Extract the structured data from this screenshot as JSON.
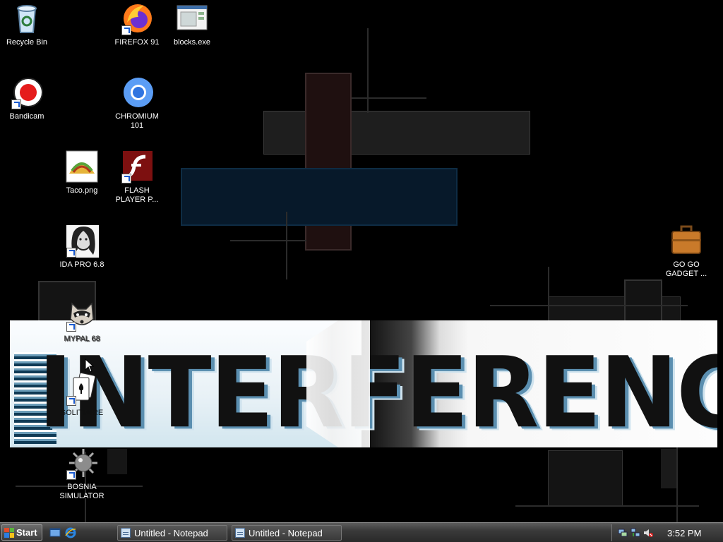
{
  "desktop": {
    "icons": [
      {
        "label": "Recycle Bin",
        "icon": "recycle-bin-icon"
      },
      {
        "label": "FIREFOX 91",
        "icon": "firefox-icon"
      },
      {
        "label": "blocks.exe",
        "icon": "blocks-app-icon"
      },
      {
        "label": "Bandicam",
        "icon": "bandicam-icon"
      },
      {
        "label": "CHROMIUM 101",
        "icon": "chromium-icon"
      },
      {
        "label": "Taco.png",
        "icon": "taco-image-icon"
      },
      {
        "label": "FLASH PLAYER P...",
        "icon": "flash-player-icon"
      },
      {
        "label": "IDA PRO 6.8",
        "icon": "ida-pro-icon"
      },
      {
        "label": "GO GO GADGET ...",
        "icon": "briefcase-icon"
      },
      {
        "label": "MYPAL 68",
        "icon": "mypal-raccoon-icon"
      },
      {
        "label": "SOLITIAIRE",
        "icon": "solitaire-cards-icon"
      },
      {
        "label": "BOSNIA SIMULATOR",
        "icon": "mine-icon"
      }
    ],
    "banner_text": "INTERFERENCE"
  },
  "taskbar": {
    "start_label": "Start",
    "quick_launch": [
      {
        "icon": "show-desktop-icon"
      },
      {
        "icon": "internet-explorer-icon"
      }
    ],
    "tasks": [
      {
        "label": "Untitled - Notepad",
        "icon": "notepad-icon"
      },
      {
        "label": "Untitled - Notepad",
        "icon": "notepad-icon"
      }
    ],
    "tray": {
      "icons": [
        "network-icon",
        "network-activity-icon",
        "volume-muted-icon"
      ],
      "clock": "3:52 PM"
    }
  },
  "colors": {
    "desktop_bg": "#000000",
    "taskbar_bg": "#3a3a3a",
    "wallpaper_blue": "#0a1a2a",
    "wallpaper_maroon": "#1f0f0f"
  }
}
